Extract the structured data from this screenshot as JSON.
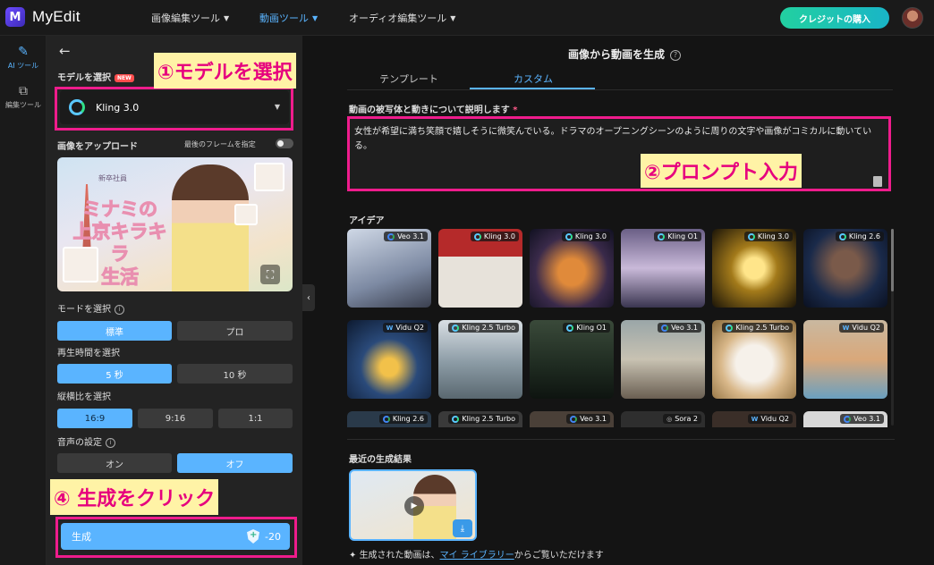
{
  "app": {
    "logo_letter": "M",
    "name": "MyEdit"
  },
  "topnav": [
    {
      "label": "画像編集ツール"
    },
    {
      "label": "動画ツール"
    },
    {
      "label": "オーディオ編集ツール"
    }
  ],
  "credit_button": "クレジットの購入",
  "rail": [
    {
      "label": "AI ツール",
      "icon": "magic-wand-icon"
    },
    {
      "label": "編集ツール",
      "icon": "layers-icon"
    }
  ],
  "sidebar": {
    "model_label": "モデルを選択",
    "new_badge": "NEW",
    "model_value": "Kling 3.0",
    "upload_label": "画像をアップロード",
    "last_frame_label": "最後のフレームを指定",
    "upload_image_text": {
      "title_line1": "ミナミの",
      "title_line2": "上京キラキラ",
      "title_line3": "生活",
      "small": "新卒社員"
    },
    "mode_label": "モードを選択",
    "mode_options": [
      "標準",
      "プロ"
    ],
    "duration_label": "再生時間を選択",
    "duration_options": [
      "5 秒",
      "10 秒"
    ],
    "ratio_label": "縦横比を選択",
    "ratio_options": [
      "16:9",
      "9:16",
      "1:1"
    ],
    "audio_label": "音声の設定",
    "audio_options": [
      "オン",
      "オフ"
    ],
    "generate_label": "生成",
    "generate_cost": "-20"
  },
  "annotations": {
    "step1": "①モデルを選択",
    "step2": "②プロンプト入力",
    "step4": "④ 生成をクリック"
  },
  "main": {
    "title": "画像から動画を生成",
    "tabs": [
      "テンプレート",
      "カスタム"
    ],
    "prompt_label": "動画の被写体と動きについて説明します",
    "prompt_required": "*",
    "prompt_text": "女性が希望に満ち笑顔で嬉しそうに微笑んでいる。ドラマのオープニングシーンのように周りの文字や画像がコミカルに動いている。",
    "ideas_label": "アイデア",
    "ideas": [
      {
        "model": "Veo 3.1",
        "logo": "google"
      },
      {
        "model": "Kling 3.0",
        "logo": "kling"
      },
      {
        "model": "Kling 3.0",
        "logo": "kling"
      },
      {
        "model": "Kling O1",
        "logo": "kling"
      },
      {
        "model": "Kling 3.0",
        "logo": "kling"
      },
      {
        "model": "Kling 2.6",
        "logo": "kling"
      },
      {
        "model": "Vidu Q2",
        "logo": "vidu"
      },
      {
        "model": "Kling 2.5 Turbo",
        "logo": "kling"
      },
      {
        "model": "Kling O1",
        "logo": "kling"
      },
      {
        "model": "Veo 3.1",
        "logo": "google"
      },
      {
        "model": "Kling 2.5 Turbo",
        "logo": "kling"
      },
      {
        "model": "Vidu Q2",
        "logo": "vidu"
      },
      {
        "model": "Kling 2.6",
        "logo": "kling"
      },
      {
        "model": "Kling 2.5 Turbo",
        "logo": "kling"
      },
      {
        "model": "Veo 3.1",
        "logo": "google"
      },
      {
        "model": "Sora 2",
        "logo": "sora"
      },
      {
        "model": "Vidu Q2",
        "logo": "vidu"
      },
      {
        "model": "Veo 3.1",
        "logo": "google"
      }
    ],
    "recent_label": "最近の生成結果",
    "footnote_prefix": "生成された動画は、",
    "footnote_link": "マイ ライブラリー",
    "footnote_suffix": "からご覧いただけます"
  },
  "colors": {
    "accent": "#5ab4ff",
    "annotation_pink": "#ef1c8c",
    "annotation_bg": "#fff3a6"
  }
}
